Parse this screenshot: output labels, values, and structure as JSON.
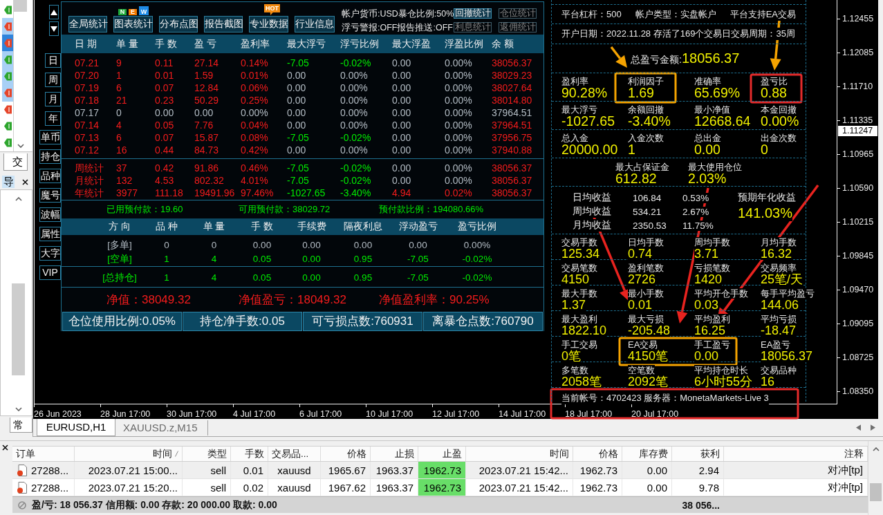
{
  "navigator": {
    "items": [
      {
        "kind": "buy",
        "selected": false,
        "highlighted": false
      },
      {
        "kind": "sell",
        "selected": false,
        "highlighted": true
      },
      {
        "kind": "sell",
        "selected": true,
        "highlighted": true
      },
      {
        "kind": "buy",
        "selected": false,
        "highlighted": true
      },
      {
        "kind": "buy",
        "selected": false,
        "highlighted": true
      },
      {
        "kind": "sell",
        "selected": false,
        "highlighted": true
      },
      {
        "kind": "sell",
        "selected": false,
        "highlighted": false
      },
      {
        "kind": "buy",
        "selected": false,
        "highlighted": false
      },
      {
        "kind": "buy",
        "selected": false,
        "highlighted": false
      }
    ],
    "tab": "交",
    "panel_title": "导",
    "bottom_tab": "常"
  },
  "side_panel": {
    "periods": [
      "日",
      "周",
      "月",
      "年"
    ],
    "filters": [
      "单币",
      "持仓",
      "品种",
      "魔号",
      "波幅",
      "属性",
      "大字",
      "VIP"
    ]
  },
  "toolbar": {
    "buttons": [
      {
        "label": "全局统计"
      },
      {
        "label": "图表统计",
        "badge": {
          "kind": "new",
          "letters": [
            {
              "text": "N",
              "color": "#1fa83a"
            },
            {
              "text": "E",
              "color": "#f27a00"
            },
            {
              "text": "W",
              "color": "#1e8be6"
            }
          ]
        }
      },
      {
        "label": "分布点图"
      },
      {
        "label": "报告截图"
      },
      {
        "label": "专业数据",
        "badge": {
          "kind": "hot",
          "text": "HOT"
        }
      },
      {
        "label": "行业信息"
      }
    ],
    "info": [
      "帐户货币:USD暴仓比例:50%",
      "浮亏警报:OFF报告推送:OFF"
    ],
    "stat_buttons": [
      {
        "label": "回撤统计",
        "disabled": false
      },
      {
        "label": "仓位统计",
        "disabled": true
      },
      {
        "label": "利息统计",
        "disabled": true
      },
      {
        "label": "返佣统计",
        "disabled": true
      }
    ]
  },
  "daily": {
    "columns": [
      "日 期",
      "单 量",
      "手 数",
      "盈 亏",
      "盈利率",
      "最大浮亏",
      "浮亏比例",
      "最大浮盈",
      "浮盈比例",
      "余 额"
    ],
    "rows": [
      {
        "cells": [
          "07.21",
          "9",
          "0.11",
          "27.14",
          "0.14%",
          "-7.05",
          "-0.02%",
          "0.00",
          "0.00%",
          "38056.37"
        ],
        "active": true,
        "float_loss": true,
        "float_gain": false
      },
      {
        "cells": [
          "07.20",
          "1",
          "0.01",
          "1.59",
          "0.01%",
          "0.00",
          "0.00%",
          "0.00",
          "0.00%",
          "38029.23"
        ],
        "active": true,
        "float_loss": false,
        "float_gain": false
      },
      {
        "cells": [
          "07.19",
          "6",
          "0.07",
          "12.84",
          "0.06%",
          "0.00",
          "0.00%",
          "0.00",
          "0.00%",
          "38027.64"
        ],
        "active": true,
        "float_loss": false,
        "float_gain": false
      },
      {
        "cells": [
          "07.18",
          "21",
          "0.23",
          "50.29",
          "0.25%",
          "0.00",
          "0.00%",
          "0.00",
          "0.00%",
          "38014.80"
        ],
        "active": true,
        "float_loss": false,
        "float_gain": false
      },
      {
        "cells": [
          "07.17",
          "0",
          "0.00",
          "0.00",
          "0.00%",
          "0.00",
          "0.00%",
          "0.00",
          "0.00%",
          "37964.51"
        ],
        "active": false,
        "float_loss": false,
        "float_gain": false
      },
      {
        "cells": [
          "07.14",
          "4",
          "0.05",
          "7.76",
          "0.04%",
          "0.00",
          "0.00%",
          "0.00",
          "0.00%",
          "37964.51"
        ],
        "active": true,
        "float_loss": false,
        "float_gain": false
      },
      {
        "cells": [
          "07.13",
          "6",
          "0.07",
          "15.87",
          "0.08%",
          "-7.05",
          "-0.02%",
          "0.00",
          "0.00%",
          "37956.75"
        ],
        "active": true,
        "float_loss": true,
        "float_gain": false
      },
      {
        "cells": [
          "07.12",
          "16",
          "0.44",
          "84.73",
          "0.42%",
          "0.00",
          "0.00%",
          "0.00",
          "0.00%",
          "37940.88"
        ],
        "active": true,
        "float_loss": false,
        "float_gain": false
      }
    ],
    "summary": [
      {
        "cells": [
          "周统计",
          "37",
          "0.42",
          "91.86",
          "0.46%",
          "-7.05",
          "-0.02%",
          "0.00",
          "0.00%",
          "38056.37"
        ],
        "active": true,
        "float_loss": true,
        "float_gain": false
      },
      {
        "cells": [
          "月统计",
          "132",
          "4.53",
          "802.32",
          "4.01%",
          "-7.05",
          "-0.02%",
          "0.00",
          "0.00%",
          "38056.37"
        ],
        "active": true,
        "float_loss": true,
        "float_gain": false
      },
      {
        "cells": [
          "年统计",
          "3977",
          "111.18",
          "19491.96",
          "97.46%",
          "-1027.65",
          "-3.40%",
          "4.94",
          "0.02%",
          "38056.37"
        ],
        "active": true,
        "float_loss": true,
        "float_gain": true
      }
    ]
  },
  "margin": [
    "已用预付款：19.60",
    "可用预付款：38029.72",
    "预付款比例：194080.66%"
  ],
  "positions": {
    "columns": [
      "方 向",
      "品 种",
      "单 量",
      "手 数",
      "手续费",
      "隔夜利息",
      "浮动盈亏",
      "盈亏比例"
    ],
    "rows": [
      {
        "cells": [
          "[多单]",
          "0",
          "0",
          "0.00",
          "0.00",
          "0.00",
          "0.00",
          "0.00%"
        ],
        "active": false
      },
      {
        "cells": [
          "[空单]",
          "1",
          "4",
          "0.05",
          "0.00",
          "0.95",
          "-7.05",
          "-0.02%"
        ],
        "active": true
      }
    ],
    "total": {
      "cells": [
        "[总持仓]",
        "1",
        "4",
        "0.05",
        "0.00",
        "0.95",
        "-7.05",
        "-0.02%"
      ],
      "active": true
    }
  },
  "equity": [
    "净值：38049.32",
    "净值盈亏：18049.32",
    "净值盈利率：90.25%"
  ],
  "footer": [
    "仓位使用比例:0.05%",
    "持仓净手数:0.05",
    "可亏损点数:760931",
    "离暴仓点数:760790"
  ],
  "report": {
    "rows": [
      {
        "kind": "line",
        "texts": [
          "平台杠杆：500",
          "帐户类型：实盘帐户",
          "平台支持EA交易"
        ]
      },
      {
        "kind": "line",
        "texts": [
          "开户日期：2022.11.28 存活了169个交易日交易周期：35周"
        ]
      },
      {
        "kind": "total",
        "label": "总盈亏金额:",
        "value": "18056.37"
      },
      {
        "kind": "metrics",
        "cells": [
          {
            "label": "盈利率",
            "value": "90.28%"
          },
          {
            "label": "利润因子",
            "value": "1.69"
          },
          {
            "label": "准确率",
            "value": "65.69%"
          },
          {
            "label": "盈亏比",
            "value": "0.88"
          }
        ]
      },
      {
        "kind": "metrics",
        "cells": [
          {
            "label": "最大浮亏",
            "value": "-1027.65"
          },
          {
            "label": "余额回撤",
            "value": "-3.40%"
          },
          {
            "label": "最小净值",
            "value": "12668.64"
          },
          {
            "label": "本金回撤",
            "value": "0.00%"
          }
        ]
      },
      {
        "kind": "metrics",
        "cells": [
          {
            "label": "总入金",
            "value": "20000.00"
          },
          {
            "label": "入金次数",
            "value": "1"
          },
          {
            "label": "总出金",
            "value": "0.00"
          },
          {
            "label": "出金次数",
            "value": "0"
          }
        ]
      },
      {
        "kind": "pair",
        "cells": [
          {
            "label": "最大占保证金",
            "value": "612.82"
          },
          {
            "label": "最大使用仓位",
            "value": "2.03%"
          }
        ]
      },
      {
        "kind": "averages",
        "lines": [
          {
            "label": "日均收益",
            "amount": "106.84",
            "rate": "0.53%"
          },
          {
            "label": "周均收益",
            "amount": "534.21",
            "rate": "2.67%"
          },
          {
            "label": "月均收益",
            "amount": "2350.53",
            "rate": "11.75%"
          }
        ],
        "forecast": {
          "label": "预期年化收益",
          "value": "141.03%"
        }
      },
      {
        "kind": "counts",
        "cells": [
          {
            "label": "交易手数",
            "value": "125.34"
          },
          {
            "label": "日均手数",
            "value": "0.74"
          },
          {
            "label": "周均手数",
            "value": "3.71"
          },
          {
            "label": "月均手数",
            "value": "16.32"
          }
        ]
      },
      {
        "kind": "counts",
        "cells": [
          {
            "label": "交易笔数",
            "value": "4150"
          },
          {
            "label": "盈利笔数",
            "value": "2726"
          },
          {
            "label": "亏损笔数",
            "value": "1420"
          },
          {
            "label": "交易频率",
            "value": "25笔/天"
          }
        ]
      },
      {
        "kind": "counts",
        "cells": [
          {
            "label": "最大手数",
            "value": "1.37"
          },
          {
            "label": "最小手数",
            "value": "0.01"
          },
          {
            "label": "平均开仓手数",
            "value": "0.03"
          },
          {
            "label": "每手平均盈亏",
            "value": "144.06"
          }
        ]
      },
      {
        "kind": "counts",
        "cells": [
          {
            "label": "最大盈利",
            "value": "1822.10"
          },
          {
            "label": "最大亏损",
            "value": "-205.48"
          },
          {
            "label": "平均盈利",
            "value": "16.25"
          },
          {
            "label": "平均亏损",
            "value": "-18.47"
          }
        ]
      },
      {
        "kind": "counts",
        "cells": [
          {
            "label": "手工交易",
            "value": "0笔"
          },
          {
            "label": "EA交易",
            "value": "4150笔"
          },
          {
            "label": "手工盈亏",
            "value": "0.00"
          },
          {
            "label": "EA盈亏",
            "value": "18056.37"
          }
        ]
      },
      {
        "kind": "counts",
        "cells": [
          {
            "label": "多笔数",
            "value": "2058笔"
          },
          {
            "label": "空笔数",
            "value": "2092笔"
          },
          {
            "label": "平均持仓时长",
            "value": "6小时55分"
          },
          {
            "label": "交易品种",
            "value": "16"
          }
        ]
      },
      {
        "kind": "line",
        "texts": [
          "当前帐号：4702423 服务器：MonetaMarkets-Live 3"
        ]
      }
    ]
  },
  "price_axis": {
    "labels": [
      "1.12455",
      "1.12085",
      "1.11710",
      "1.11335",
      "1.10965",
      "1.10590",
      "1.10215",
      "1.09845",
      "1.09470",
      "1.09095",
      "1.08725",
      "1.08350"
    ],
    "current": "1.11247"
  },
  "time_axis": [
    "26 Jun 2023",
    "28 Jun 17:00",
    "30 Jun 17:00",
    "4 Jul 17:00",
    "6 Jul 17:00",
    "10 Jul 17:00",
    "12 Jul 17:00",
    "14 Jul 17:00",
    "18 Jul 17:00",
    "20 Jul 17:00"
  ],
  "chart_tabs": [
    {
      "label": "EURUSD,H1",
      "selected": true
    },
    {
      "label": "XAUUSD.z,M15",
      "selected": false
    }
  ],
  "terminal": {
    "columns": [
      {
        "label": "订单",
        "sorted": false
      },
      {
        "label": "时间",
        "sorted": true
      },
      {
        "label": "类型",
        "sorted": false
      },
      {
        "label": "手数",
        "sorted": false
      },
      {
        "label": "交易品...",
        "sorted": false
      },
      {
        "label": "价格",
        "sorted": false
      },
      {
        "label": "止损",
        "sorted": false
      },
      {
        "label": "止盈",
        "sorted": false
      },
      {
        "label": "时间",
        "sorted": false
      },
      {
        "label": "价格",
        "sorted": false
      },
      {
        "label": "库存费",
        "sorted": false
      },
      {
        "label": "获利",
        "sorted": false
      },
      {
        "label": "注释",
        "sorted": false
      }
    ],
    "rows": [
      {
        "cells": [
          "27288...",
          "2023.07.21 15:00...",
          "sell",
          "0.01",
          "xauusd",
          "1965.67",
          "1963.37",
          "1962.73",
          "2023.07.21 15:42...",
          "1962.73",
          "0.00",
          "2.94",
          "对冲[tp]"
        ],
        "tp_hit": true
      },
      {
        "cells": [
          "27288...",
          "2023.07.21 15:20...",
          "sell",
          "0.02",
          "xauusd",
          "1967.62",
          "1963.37",
          "1962.73",
          "2023.07.21 15:42...",
          "1962.73",
          "0.00",
          "9.78",
          "对冲[tp]"
        ],
        "tp_hit": true
      }
    ],
    "summary": "盈/亏: 18 056.37 信用额: 0.00 存款: 20 000.00 取款: 0.00",
    "balance": "38 056..."
  },
  "annotations": {
    "arrows": [
      {
        "color": "#f5a300"
      },
      {
        "color": "#f5a300"
      },
      {
        "color": "#e8231f"
      },
      {
        "color": "#e8231f"
      },
      {
        "color": "#e8231f"
      }
    ],
    "frames": [
      {
        "color": "#f5a300"
      },
      {
        "color": "#e52b2b"
      },
      {
        "color": "#f5a300"
      },
      {
        "color": "#e52b2b"
      }
    ]
  }
}
